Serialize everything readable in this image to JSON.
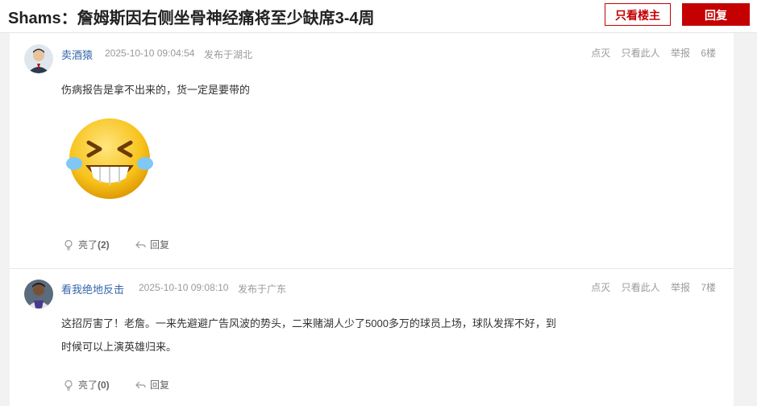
{
  "header": {
    "title": "Shams：詹姆斯因右侧坐骨神经痛将至少缺席3-4周",
    "op_only_label": "只看楼主",
    "reply_label": "回复"
  },
  "posts": [
    {
      "username": "卖酒猿",
      "timestamp": "2025-10-10 09:04:54",
      "location": "发布于湖北",
      "actions": [
        "点灭",
        "只看此人",
        "举报"
      ],
      "floor": "6楼",
      "text": "伤病报告是拿不出来的，货一定是要带的",
      "emoji": "laughing-tears-emoji",
      "like_label": "亮了",
      "like_count": "(2)",
      "reply_label": "回复"
    },
    {
      "username": "看我绝地反击",
      "timestamp": "2025-10-10 09:08:10",
      "location": "发布于广东",
      "actions": [
        "点灭",
        "只看此人",
        "举报"
      ],
      "floor": "7楼",
      "text_line1": "这招厉害了！老詹。一来先避避广告风波的势头，二来赌湖人少了5000多万的球员上场，球队发挥不好，到",
      "text_line2": "时候可以上演英雄归来。",
      "like_label": "亮了",
      "like_count": "(0)",
      "reply_label": "回复"
    }
  ],
  "colors": {
    "accent": "#c40000",
    "link": "#3366aa",
    "muted": "#999999",
    "emoji_yellow": "#f7c21a"
  }
}
